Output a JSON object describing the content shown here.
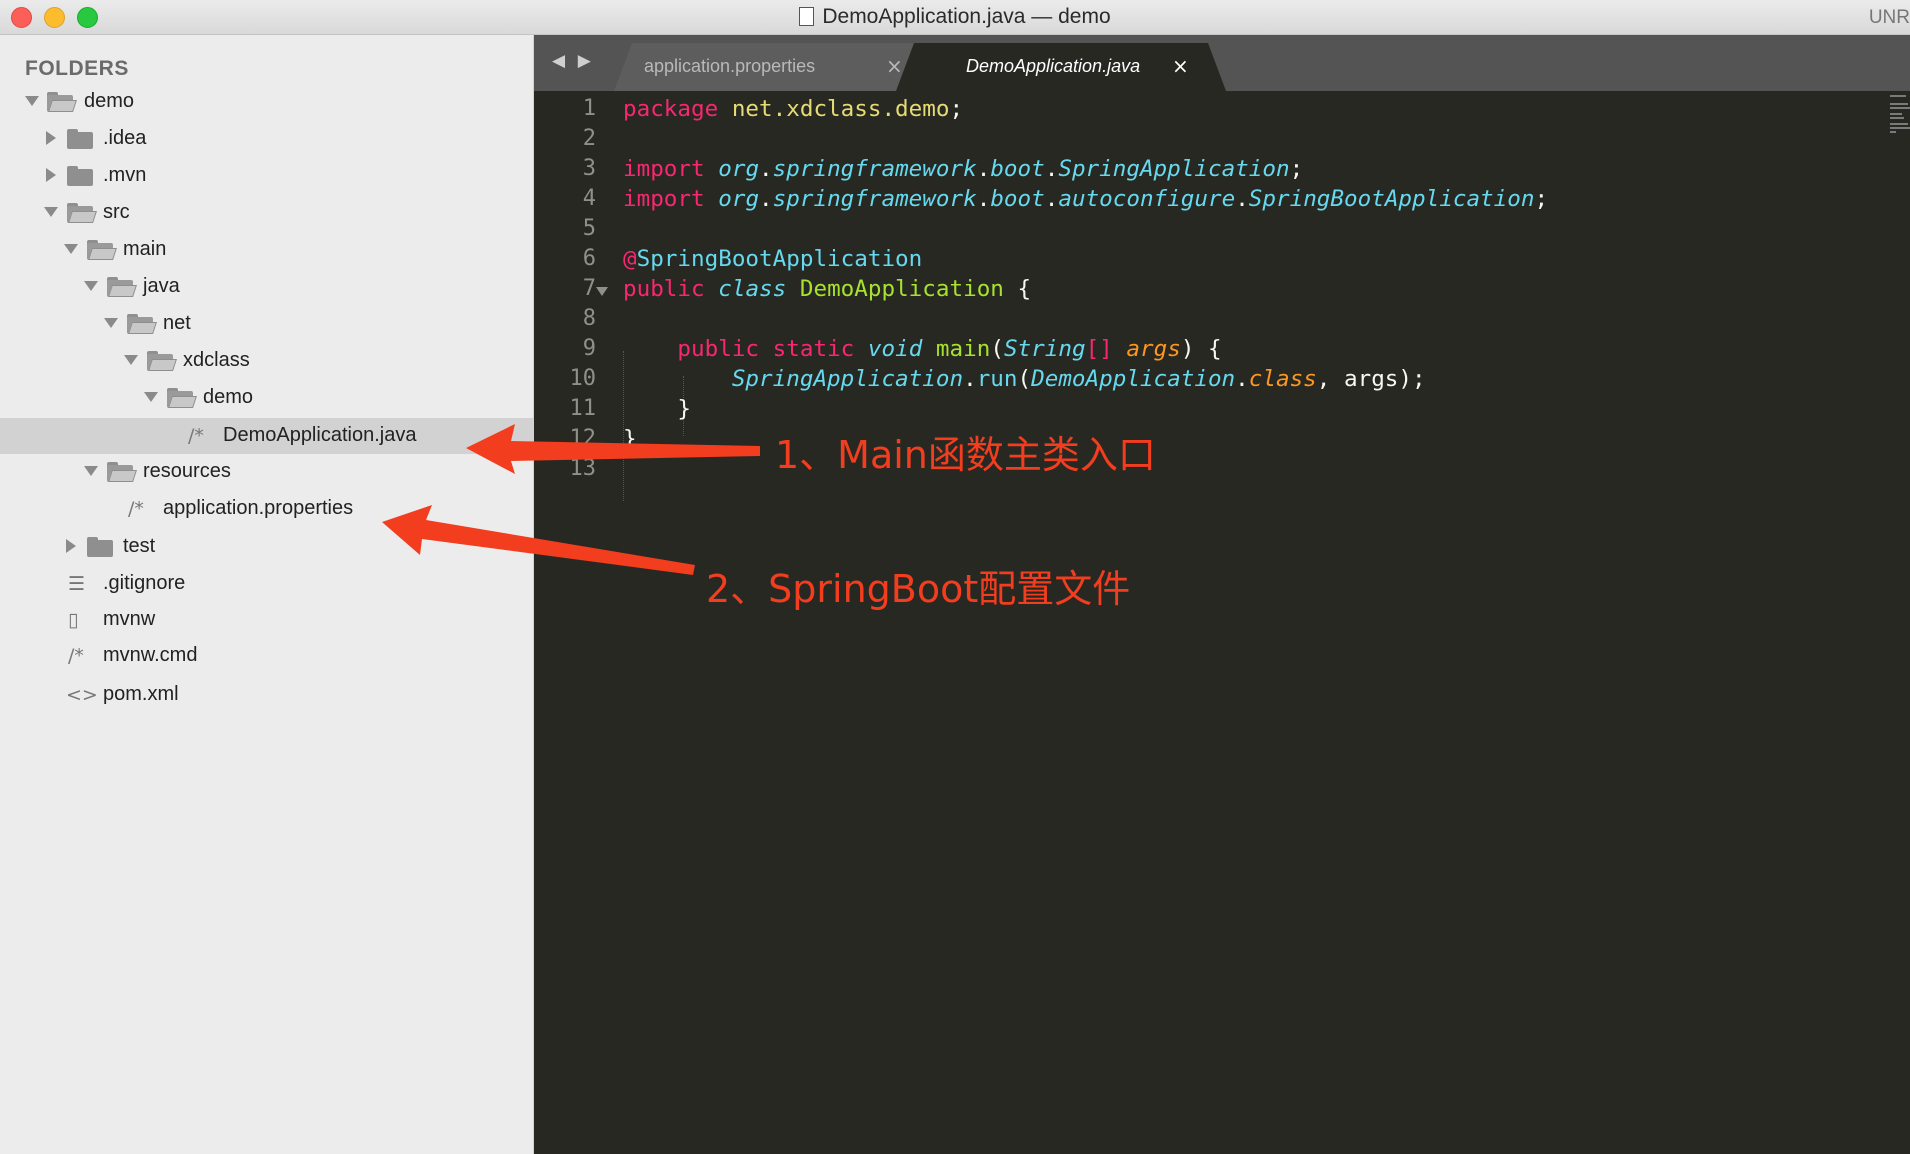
{
  "window": {
    "title": "DemoApplication.java — demo",
    "right_text": "UNR",
    "colors": {
      "close": "#fc5f57",
      "minimize": "#fdbc2e",
      "zoom": "#28c840"
    }
  },
  "sidebar": {
    "header": "FOLDERS",
    "items": [
      {
        "label": "demo",
        "icon": "folder-open-icon",
        "arrow": "down"
      },
      {
        "label": ".idea",
        "icon": "folder-icon",
        "arrow": "right"
      },
      {
        "label": ".mvn",
        "icon": "folder-icon",
        "arrow": "right"
      },
      {
        "label": "src",
        "icon": "folder-open-icon",
        "arrow": "down"
      },
      {
        "label": "main",
        "icon": "folder-open-icon",
        "arrow": "down"
      },
      {
        "label": "java",
        "icon": "folder-open-icon",
        "arrow": "down"
      },
      {
        "label": "net",
        "icon": "folder-open-icon",
        "arrow": "down"
      },
      {
        "label": "xdclass",
        "icon": "folder-open-icon",
        "arrow": "down"
      },
      {
        "label": "demo",
        "icon": "folder-open-icon",
        "arrow": "down"
      },
      {
        "label": "DemoApplication.java",
        "icon": "comment-file-icon",
        "glyph": "/*",
        "selected": true
      },
      {
        "label": "resources",
        "icon": "folder-open-icon",
        "arrow": "down"
      },
      {
        "label": "application.properties",
        "icon": "comment-file-icon",
        "glyph": "/*"
      },
      {
        "label": "test",
        "icon": "folder-icon",
        "arrow": "right"
      },
      {
        "label": ".gitignore",
        "icon": "text-lines-icon",
        "glyph": "☰"
      },
      {
        "label": "mvnw",
        "icon": "document-icon",
        "glyph": "▯"
      },
      {
        "label": "mvnw.cmd",
        "icon": "comment-file-icon",
        "glyph": "/*"
      },
      {
        "label": "pom.xml",
        "icon": "markup-file-icon",
        "glyph": "<>"
      }
    ]
  },
  "editor": {
    "nav_arrows": "◀ ▶",
    "tabs": [
      {
        "label": "application.properties",
        "active": false,
        "close": "×"
      },
      {
        "label": "DemoApplication.java",
        "active": true,
        "close": "×"
      }
    ],
    "line_numbers": [
      "1",
      "2",
      "3",
      "4",
      "5",
      "6",
      "7",
      "8",
      "9",
      "10",
      "11",
      "12",
      "13"
    ],
    "lines": {
      "l1": {
        "a": "package",
        "b": " ",
        "c": "net.xdclass.demo",
        "d": ";"
      },
      "l3": {
        "a": "import",
        "b": " ",
        "c": "org",
        "d": ".",
        "e": "springframework",
        "f": ".",
        "g": "boot",
        "h": ".",
        "i": "SpringApplication",
        "j": ";"
      },
      "l4": {
        "a": "import",
        "b": " ",
        "c": "org",
        "d": ".",
        "e": "springframework",
        "f": ".",
        "g": "boot",
        "h": ".",
        "i": "autoconfigure",
        "j": ".",
        "k": "SpringBootApplication",
        "l": ";"
      },
      "l6": {
        "a": "@",
        "b": "SpringBootApplication"
      },
      "l7": {
        "a": "public",
        "b": " ",
        "c": "class",
        "d": " ",
        "e": "DemoApplication",
        "f": " {"
      },
      "l9": {
        "ind": "    ",
        "a": "public",
        "b": " ",
        "c": "static",
        "d": " ",
        "e": "void",
        "f": " ",
        "g": "main",
        "h": "(",
        "i": "String",
        "j": "[]",
        "k": " ",
        "l": "args",
        "m": ") {"
      },
      "l10": {
        "ind": "        ",
        "a": "SpringApplication",
        "b": ".",
        "c": "run",
        "d": "(",
        "e": "DemoApplication",
        "f": ".",
        "g": "class",
        "h": ", args);"
      },
      "l11": {
        "ind": "    ",
        "a": "}"
      },
      "l12": {
        "a": "}"
      }
    },
    "colors": {
      "background": "#272822",
      "keyword": "#f92672",
      "string": "#e6db74",
      "type": "#66d9ef",
      "function": "#a6e22e",
      "param": "#fd971f"
    }
  },
  "annotations": {
    "main_entry": "1、Main函数主类入口",
    "config_file": "2、SpringBoot配置文件",
    "color": "#f23d1f"
  }
}
